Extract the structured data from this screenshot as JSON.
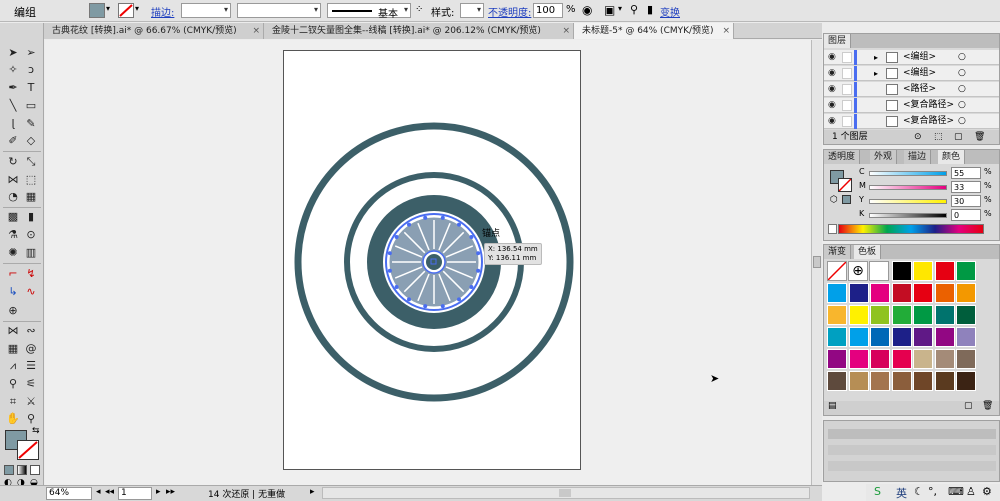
{
  "control_bar": {
    "mode_label": "编组",
    "stroke_link": "描边:",
    "stroke_style": "基本",
    "style_label": "样式:",
    "opacity_link": "不透明度:",
    "opacity_value": "100",
    "percent": "%",
    "transform_link": "变换"
  },
  "tabs": [
    {
      "label": "古典花纹 [转换].ai* @ 66.67% (CMYK/预览)",
      "close": "×"
    },
    {
      "label": "金陵十二钗矢量图全集--线稿 [转换].ai* @ 206.12% (CMYK/预览)",
      "close": "×"
    },
    {
      "label": "未标题-5* @ 64% (CMYK/预览)",
      "close": "×"
    }
  ],
  "tooltip": {
    "label": "锚点",
    "xy": "X: 136.54 mm\nY: 136.11 mm"
  },
  "status": {
    "zoom": "64%",
    "page": "1",
    "history": "14 次还原 | 无重做"
  },
  "layers_panel": {
    "title": "图层",
    "rows": [
      "<编组>",
      "<编组>",
      "<路径>",
      "<复合路径>",
      "<复合路径>"
    ],
    "footer": "1 个图层"
  },
  "color_panel": {
    "tabs": [
      "透明度",
      "外观",
      "描边",
      "颜色"
    ],
    "channels": [
      {
        "name": "C",
        "value": "55"
      },
      {
        "name": "M",
        "value": "33"
      },
      {
        "name": "Y",
        "value": "30"
      },
      {
        "name": "K",
        "value": "0"
      }
    ]
  },
  "swatches_panel": {
    "tabs": [
      "渐变",
      "色板"
    ],
    "rows": [
      [
        "#000000",
        "#ffe700",
        "#e60012",
        "#009944"
      ],
      [
        "#00a0e9",
        "#1d2088",
        "#e4007f",
        "#c30d23",
        "#e60012",
        "#eb6100",
        "#f39800"
      ],
      [
        "#f8b62d",
        "#fff100",
        "#8fc31f",
        "#22ac38",
        "#009944",
        "#00736d",
        "#005e3c"
      ],
      [
        "#00a0c1",
        "#00a0e9",
        "#0068b7",
        "#1d2088",
        "#601986",
        "#920783",
        "#8f82bc"
      ],
      [
        "#920783",
        "#e4007f",
        "#d7005b",
        "#e5004f",
        "#c9b48c",
        "#a48b78",
        "#7f6a5a"
      ],
      [
        "#5e4a3d",
        "#b68e55",
        "#a3744e",
        "#8b5e3c",
        "#6f4628",
        "#5a3a1f",
        "#3b2314"
      ]
    ]
  },
  "colors": {
    "accent": "#3c5f68",
    "chrome": "#d9d9d9",
    "canvas": "#efefef",
    "selection": "#4a6df0"
  },
  "ime": {
    "label": "英"
  }
}
